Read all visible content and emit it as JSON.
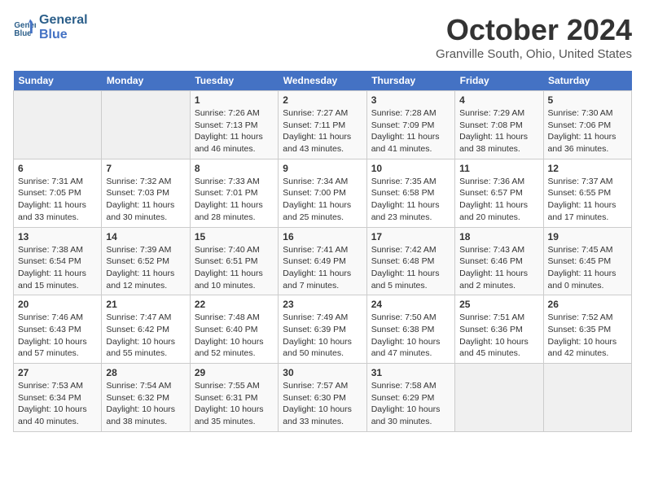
{
  "logo": {
    "line1": "General",
    "line2": "Blue"
  },
  "title": "October 2024",
  "location": "Granville South, Ohio, United States",
  "weekdays": [
    "Sunday",
    "Monday",
    "Tuesday",
    "Wednesday",
    "Thursday",
    "Friday",
    "Saturday"
  ],
  "weeks": [
    [
      {
        "day": "",
        "info": ""
      },
      {
        "day": "",
        "info": ""
      },
      {
        "day": "1",
        "info": "Sunrise: 7:26 AM\nSunset: 7:13 PM\nDaylight: 11 hours and 46 minutes."
      },
      {
        "day": "2",
        "info": "Sunrise: 7:27 AM\nSunset: 7:11 PM\nDaylight: 11 hours and 43 minutes."
      },
      {
        "day": "3",
        "info": "Sunrise: 7:28 AM\nSunset: 7:09 PM\nDaylight: 11 hours and 41 minutes."
      },
      {
        "day": "4",
        "info": "Sunrise: 7:29 AM\nSunset: 7:08 PM\nDaylight: 11 hours and 38 minutes."
      },
      {
        "day": "5",
        "info": "Sunrise: 7:30 AM\nSunset: 7:06 PM\nDaylight: 11 hours and 36 minutes."
      }
    ],
    [
      {
        "day": "6",
        "info": "Sunrise: 7:31 AM\nSunset: 7:05 PM\nDaylight: 11 hours and 33 minutes."
      },
      {
        "day": "7",
        "info": "Sunrise: 7:32 AM\nSunset: 7:03 PM\nDaylight: 11 hours and 30 minutes."
      },
      {
        "day": "8",
        "info": "Sunrise: 7:33 AM\nSunset: 7:01 PM\nDaylight: 11 hours and 28 minutes."
      },
      {
        "day": "9",
        "info": "Sunrise: 7:34 AM\nSunset: 7:00 PM\nDaylight: 11 hours and 25 minutes."
      },
      {
        "day": "10",
        "info": "Sunrise: 7:35 AM\nSunset: 6:58 PM\nDaylight: 11 hours and 23 minutes."
      },
      {
        "day": "11",
        "info": "Sunrise: 7:36 AM\nSunset: 6:57 PM\nDaylight: 11 hours and 20 minutes."
      },
      {
        "day": "12",
        "info": "Sunrise: 7:37 AM\nSunset: 6:55 PM\nDaylight: 11 hours and 17 minutes."
      }
    ],
    [
      {
        "day": "13",
        "info": "Sunrise: 7:38 AM\nSunset: 6:54 PM\nDaylight: 11 hours and 15 minutes."
      },
      {
        "day": "14",
        "info": "Sunrise: 7:39 AM\nSunset: 6:52 PM\nDaylight: 11 hours and 12 minutes."
      },
      {
        "day": "15",
        "info": "Sunrise: 7:40 AM\nSunset: 6:51 PM\nDaylight: 11 hours and 10 minutes."
      },
      {
        "day": "16",
        "info": "Sunrise: 7:41 AM\nSunset: 6:49 PM\nDaylight: 11 hours and 7 minutes."
      },
      {
        "day": "17",
        "info": "Sunrise: 7:42 AM\nSunset: 6:48 PM\nDaylight: 11 hours and 5 minutes."
      },
      {
        "day": "18",
        "info": "Sunrise: 7:43 AM\nSunset: 6:46 PM\nDaylight: 11 hours and 2 minutes."
      },
      {
        "day": "19",
        "info": "Sunrise: 7:45 AM\nSunset: 6:45 PM\nDaylight: 11 hours and 0 minutes."
      }
    ],
    [
      {
        "day": "20",
        "info": "Sunrise: 7:46 AM\nSunset: 6:43 PM\nDaylight: 10 hours and 57 minutes."
      },
      {
        "day": "21",
        "info": "Sunrise: 7:47 AM\nSunset: 6:42 PM\nDaylight: 10 hours and 55 minutes."
      },
      {
        "day": "22",
        "info": "Sunrise: 7:48 AM\nSunset: 6:40 PM\nDaylight: 10 hours and 52 minutes."
      },
      {
        "day": "23",
        "info": "Sunrise: 7:49 AM\nSunset: 6:39 PM\nDaylight: 10 hours and 50 minutes."
      },
      {
        "day": "24",
        "info": "Sunrise: 7:50 AM\nSunset: 6:38 PM\nDaylight: 10 hours and 47 minutes."
      },
      {
        "day": "25",
        "info": "Sunrise: 7:51 AM\nSunset: 6:36 PM\nDaylight: 10 hours and 45 minutes."
      },
      {
        "day": "26",
        "info": "Sunrise: 7:52 AM\nSunset: 6:35 PM\nDaylight: 10 hours and 42 minutes."
      }
    ],
    [
      {
        "day": "27",
        "info": "Sunrise: 7:53 AM\nSunset: 6:34 PM\nDaylight: 10 hours and 40 minutes."
      },
      {
        "day": "28",
        "info": "Sunrise: 7:54 AM\nSunset: 6:32 PM\nDaylight: 10 hours and 38 minutes."
      },
      {
        "day": "29",
        "info": "Sunrise: 7:55 AM\nSunset: 6:31 PM\nDaylight: 10 hours and 35 minutes."
      },
      {
        "day": "30",
        "info": "Sunrise: 7:57 AM\nSunset: 6:30 PM\nDaylight: 10 hours and 33 minutes."
      },
      {
        "day": "31",
        "info": "Sunrise: 7:58 AM\nSunset: 6:29 PM\nDaylight: 10 hours and 30 minutes."
      },
      {
        "day": "",
        "info": ""
      },
      {
        "day": "",
        "info": ""
      }
    ]
  ]
}
